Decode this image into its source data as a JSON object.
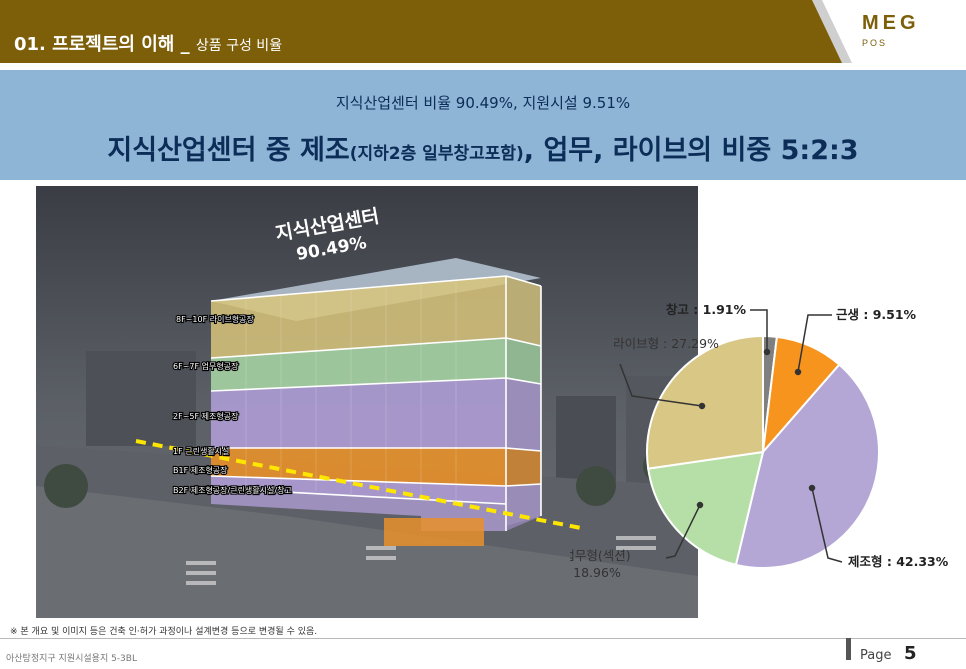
{
  "header": {
    "title": "01. 프로젝트의 이해 _",
    "subtitle": "상품 구성 비율",
    "logo": "MEG",
    "logo_sub": "POS"
  },
  "banner": {
    "subtitle": "지식산업센터 비율 90.49%, 지원시설 9.51%",
    "main_title_a": "지식산업센터 중 제조",
    "main_title_small": "(지하2층 일부창고포함)",
    "main_title_b": ", 업무, 라이브의 비중 5:2:3"
  },
  "building": {
    "headline": "지식산업센터",
    "headline_pct": "90.49%",
    "floors": [
      {
        "label": "8F~10F 라이브형공장",
        "color": "#d8c47a"
      },
      {
        "label": "6F~7F 업무형공장",
        "color": "#a9d8a6"
      },
      {
        "label": "2F~5F 제조형공장",
        "color": "#b3a0db"
      },
      {
        "label": "1F 근린생활시설",
        "color": "#e8902a"
      },
      {
        "label": "B1F 제조형공장",
        "color": "#b3a0db"
      },
      {
        "label": "B2F 제조형공장/근린생활시설/창고",
        "color": "#b3a0db"
      }
    ]
  },
  "chart_data": {
    "type": "pie",
    "slices": [
      {
        "label": "창고 : 1.91%",
        "name": "창고",
        "value": 1.91,
        "color": "#7f7f7f"
      },
      {
        "label": "근생 : 9.51%",
        "name": "근생",
        "value": 9.51,
        "color": "#f7941d"
      },
      {
        "label": "제조형 : 42.33%",
        "name": "제조형",
        "value": 42.33,
        "color": "#b4a7d6"
      },
      {
        "label_a": "업무형(섹션)",
        "label_b": "18.96%",
        "name": "업무형(섹션)",
        "value": 18.96,
        "color": "#b6dfa8"
      },
      {
        "label": "라이브형 : 27.29%",
        "name": "라이브형",
        "value": 27.29,
        "color": "#d9c785"
      }
    ]
  },
  "footnote": "※ 본 개요 및 이미지 등은 건축 인·허가 과정이나 설계변경 등으로 변경될 수 있음.",
  "footer": {
    "left": "아산탕정지구 지원시설용지 5-3BL",
    "page_label": "Page",
    "page_num": "5"
  }
}
